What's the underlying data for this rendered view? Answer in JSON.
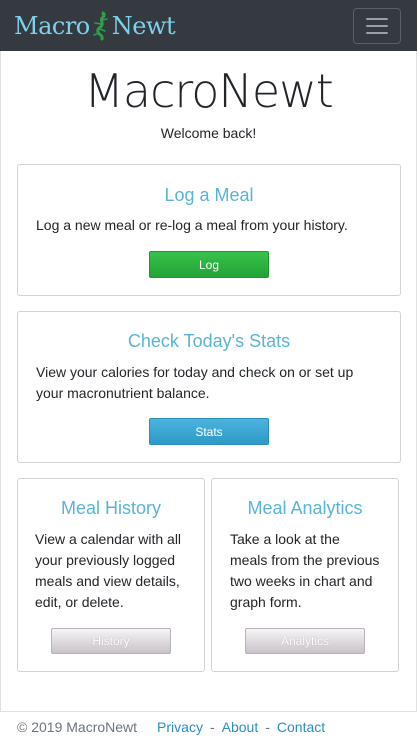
{
  "navbar": {
    "brand_part1": "Macro",
    "brand_part2": "Newt",
    "logo_icon": "newt-icon",
    "menu_icon": "hamburger-menu-icon"
  },
  "main": {
    "title": "MacroNewt",
    "welcome": "Welcome back!"
  },
  "cards": {
    "log": {
      "title": "Log a Meal",
      "description": "Log a new meal or re-log a meal from your history.",
      "button": "Log"
    },
    "stats": {
      "title": "Check Today's Stats",
      "description": "View your calories for today and check on or set up your macronutrient balance.",
      "button": "Stats"
    },
    "history": {
      "title": "Meal History",
      "description": "View a calendar with all your previously logged meals and view details, edit, or delete.",
      "button": "History"
    },
    "analytics": {
      "title": "Meal Analytics",
      "description": "Take a look at the meals from the previous two weeks in chart and graph form.",
      "button": "Analytics"
    }
  },
  "footer": {
    "copyright": "© 2019 MacroNewt",
    "links": [
      "Privacy",
      "About",
      "Contact"
    ],
    "separator": "-"
  },
  "colors": {
    "navbar_bg": "#343a40",
    "brand": "#7fd0ea",
    "card_title": "#5ab4d6",
    "log_button": "#28a745",
    "stats_button": "#35a3d0",
    "link": "#2b8ec6"
  }
}
